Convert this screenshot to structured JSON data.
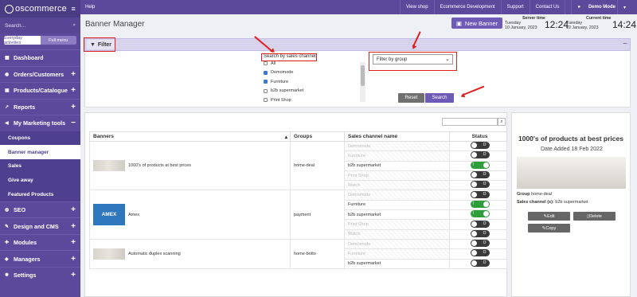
{
  "app": {
    "logo_text": "oscommerce"
  },
  "sidebar": {
    "search_placeholder": "Search...",
    "tab_everyday": "Everyday activities",
    "tab_full": "Full menu",
    "items": [
      {
        "label": "Dashboard",
        "icon": "bank-icon"
      },
      {
        "label": "Orders/Customers",
        "icon": "users-icon",
        "expand": "+"
      },
      {
        "label": "Products/Catalogue",
        "icon": "box-icon",
        "expand": "+"
      },
      {
        "label": "Reports",
        "icon": "chart-icon",
        "expand": "+"
      },
      {
        "label": "My Marketing tools",
        "icon": "megaphone-icon",
        "expand": "−"
      }
    ],
    "subitems": [
      "Coupons",
      "Banner manager",
      "Sales",
      "Give away",
      "Featured Products"
    ],
    "items2": [
      {
        "label": "SEO",
        "icon": "globe-icon",
        "expand": "+"
      },
      {
        "label": "Design and CMS",
        "icon": "brush-icon",
        "expand": "+"
      },
      {
        "label": "Modules",
        "icon": "puzzle-icon",
        "expand": "+"
      },
      {
        "label": "Managers",
        "icon": "user-tie-icon",
        "expand": "+"
      },
      {
        "label": "Settings",
        "icon": "gear-icon",
        "expand": "+"
      }
    ]
  },
  "topbar": {
    "help": "Help",
    "view_shop": "View shop",
    "ecom_dev": "Ecommerce Development",
    "support": "Support",
    "contact": "Contact Us",
    "user": "Demo Mode"
  },
  "header": {
    "title": "Banner Manager",
    "new_banner": "New Banner",
    "server_label": "Server time",
    "server_day": "Tuesday",
    "server_date": "10 January, 2023",
    "server_time": "12:24",
    "current_label": "Current time",
    "current_day": "Tuesday",
    "current_date": "10 January, 2023",
    "current_time": "14:24"
  },
  "filter": {
    "label": "Filter",
    "sc_label": "Search by sales channel",
    "channels": [
      {
        "name": "All",
        "checked": false
      },
      {
        "name": "Demomode",
        "checked": true
      },
      {
        "name": "Furniture",
        "checked": true
      },
      {
        "name": "b2b supermarket",
        "checked": false
      },
      {
        "name": "Print Shop",
        "checked": false
      }
    ],
    "group_placeholder": "Filter by group",
    "reset": "Reset",
    "search": "Search"
  },
  "table": {
    "headers": [
      "Banners",
      "Groups",
      "Sales channel name",
      "Status"
    ],
    "banners": [
      {
        "name": "1000's of products at best prices",
        "group": "home-deal",
        "channels": [
          {
            "n": "Demomode",
            "on": false,
            "active": false
          },
          {
            "n": "Furniture",
            "on": false,
            "active": false
          },
          {
            "n": "b2b supermarket",
            "on": true,
            "active": true
          },
          {
            "n": "Print Shop",
            "on": false,
            "active": false
          },
          {
            "n": "Watch",
            "on": false,
            "active": false
          }
        ]
      },
      {
        "name": "Amex",
        "group": "payment",
        "logo": "AMEX",
        "channels": [
          {
            "n": "Demomode",
            "on": false,
            "active": false
          },
          {
            "n": "Furniture",
            "on": true,
            "active": true
          },
          {
            "n": "b2b supermarket",
            "on": true,
            "active": true
          },
          {
            "n": "Print Shop",
            "on": false,
            "active": false
          },
          {
            "n": "Watch",
            "on": false,
            "active": false
          }
        ]
      },
      {
        "name": "Automatic duplex scanning",
        "group": "home-botto",
        "channels": [
          {
            "n": "Demomode",
            "on": false,
            "active": false
          },
          {
            "n": "Furniture",
            "on": false,
            "active": false
          },
          {
            "n": "b2b supermarket",
            "on": false,
            "active": true
          }
        ]
      }
    ]
  },
  "detail": {
    "title": "1000's of products at best prices",
    "date": "Date Added 18 Feb 2022",
    "group_label": "Group",
    "group": "home-deal",
    "sc_label": "Sales channel (s):",
    "sc": "b2b supermarket",
    "edit": "Edit",
    "delete": "Delete",
    "copy": "Copy"
  },
  "toggle_text": {
    "on": "I",
    "off": "O"
  },
  "colors": {
    "brand": "#5b4a9c",
    "annotation": "#e02020",
    "toggle_on": "#2e9d3c"
  }
}
